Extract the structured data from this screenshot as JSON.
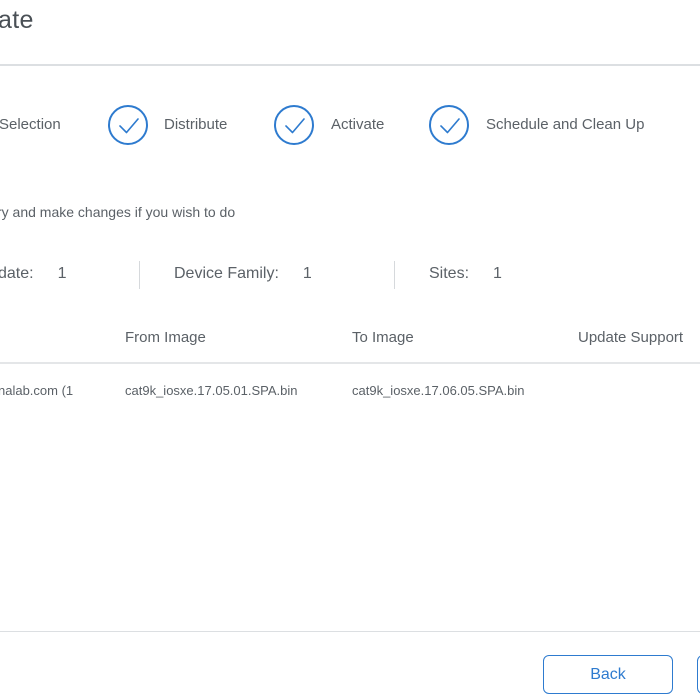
{
  "page": {
    "title": "ate"
  },
  "steps": [
    {
      "label": "Selection",
      "completed": true
    },
    {
      "label": "Distribute",
      "completed": true
    },
    {
      "label": "Activate",
      "completed": true
    },
    {
      "label": "Schedule and Clean Up",
      "completed": true
    }
  ],
  "instruction": "ry and make changes if you wish to do",
  "summary": [
    {
      "label": "date:",
      "value": "1"
    },
    {
      "label": "Device Family:",
      "value": "1"
    },
    {
      "label": "Sites:",
      "value": "1"
    }
  ],
  "table": {
    "headers": [
      "From Image",
      "To Image",
      "Update Support"
    ],
    "rows": [
      {
        "device": "nalab.com (1",
        "from_image": "cat9k_iosxe.17.05.01.SPA.bin",
        "to_image": "cat9k_iosxe.17.06.05.SPA.bin",
        "update_support": ""
      }
    ]
  },
  "footer": {
    "back_label": "Back"
  },
  "colors": {
    "accent": "#2e7bcf",
    "text": "#5b6167",
    "divider": "#dcdfe2"
  },
  "icons": {
    "step": "check-circle-icon"
  }
}
